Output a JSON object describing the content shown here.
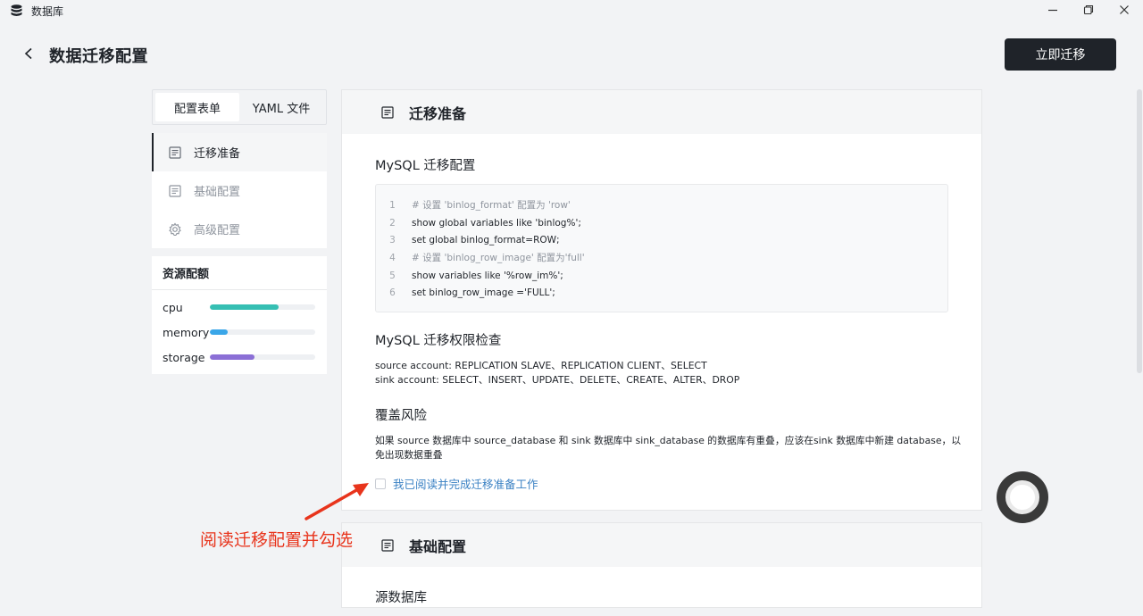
{
  "window": {
    "title": "数据库",
    "controls": [
      "minimize-icon",
      "restore-icon",
      "close-icon"
    ]
  },
  "header": {
    "title": "数据迁移配置",
    "primary_button": "立即迁移"
  },
  "tabs": [
    {
      "label": "配置表单",
      "active": true
    },
    {
      "label": "YAML 文件",
      "active": false
    }
  ],
  "nav": [
    {
      "label": "迁移准备",
      "icon": "document-icon",
      "active": true
    },
    {
      "label": "基础配置",
      "icon": "document-icon",
      "active": false
    },
    {
      "label": "高级配置",
      "icon": "gear-icon",
      "active": false
    }
  ],
  "resources": {
    "title": "资源配额",
    "items": [
      {
        "label": "cpu",
        "fraction": 0.65,
        "color": "#36bfb3"
      },
      {
        "label": "memory",
        "fraction": 0.17,
        "color": "#3aa6e8"
      },
      {
        "label": "storage",
        "fraction": 0.42,
        "color": "#8b6fd6"
      }
    ]
  },
  "section1": {
    "title": "迁移准备",
    "mysql_config": {
      "title": "MySQL 迁移配置",
      "lines": [
        {
          "n": "1",
          "text": "# 设置 'binlog_format' 配置为 'row'",
          "comment": true
        },
        {
          "n": "2",
          "text": "show global variables like 'binlog%';",
          "comment": false
        },
        {
          "n": "3",
          "text": "set global binlog_format=ROW;",
          "comment": false
        },
        {
          "n": "4",
          "text": "# 设置 'binlog_row_image' 配置为'full'",
          "comment": true
        },
        {
          "n": "5",
          "text": "show variables like '%row_im%';",
          "comment": false
        },
        {
          "n": "6",
          "text": "set binlog_row_image ='FULL';",
          "comment": false
        }
      ]
    },
    "permission": {
      "title": "MySQL 迁移权限检查",
      "source": "source account: REPLICATION SLAVE、REPLICATION CLIENT、SELECT",
      "sink": "sink account: SELECT、INSERT、UPDATE、DELETE、CREATE、ALTER、DROP"
    },
    "risk": {
      "title": "覆盖风险",
      "text_line1": "如果 source 数据库中 source_database 和 sink 数据库中 sink_database 的数据库有重叠，应该在sink 数据库中新建 database，以",
      "text_line2": "免出现数据重叠"
    },
    "checkbox_label": "我已阅读并完成迁移准备工作",
    "checked": false
  },
  "section2": {
    "title": "基础配置",
    "sub_title": "源数据库"
  },
  "annotation": {
    "text": "阅读迁移配置并勾选",
    "color": "#e8341c"
  }
}
